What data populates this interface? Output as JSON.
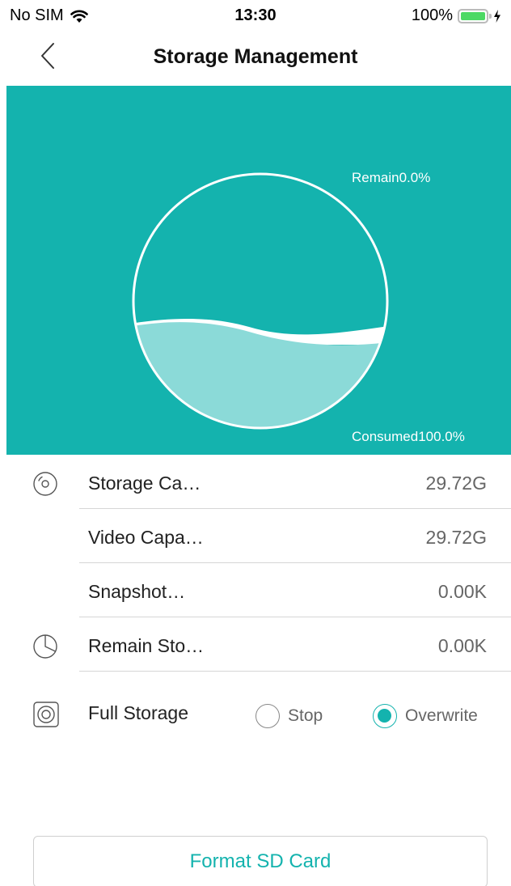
{
  "status_bar": {
    "carrier": "No SIM",
    "time": "13:30",
    "battery": "100%"
  },
  "nav": {
    "title": "Storage Management"
  },
  "storage_chart": {
    "remain_label": "Remain0.0%",
    "consumed_label": "Consumed100.0%",
    "consumed_fraction": 1.0,
    "remain_fraction": 0.0,
    "colors": {
      "background": "#14b3ae",
      "water": "#8bdad8",
      "ring": "#ffffff"
    }
  },
  "rows": [
    {
      "label": "Storage Ca…",
      "value": "29.72G",
      "icon": "disc-icon"
    },
    {
      "label": "Video Capa…",
      "value": "29.72G",
      "icon": ""
    },
    {
      "label": "Snapshot…",
      "value": "0.00K",
      "icon": ""
    },
    {
      "label": "Remain Sto…",
      "value": "0.00K",
      "icon": "pie-chart-icon"
    }
  ],
  "full_storage": {
    "label": "Full Storage",
    "options": [
      {
        "label": "Stop",
        "checked": false
      },
      {
        "label": "Overwrite",
        "checked": true
      }
    ]
  },
  "format_button": {
    "label": "Format SD Card"
  }
}
